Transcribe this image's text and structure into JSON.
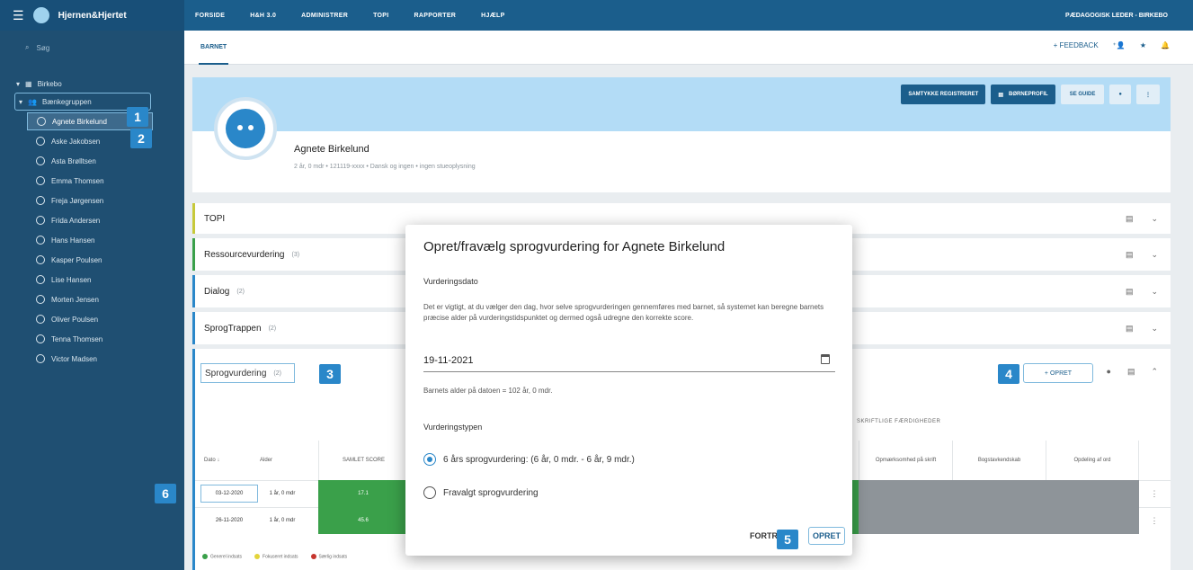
{
  "topbar": {
    "brand": "Hjernen&Hjertet",
    "nav": [
      "FORSIDE",
      "H&H 3.0",
      "ADMINISTRER",
      "TOPI",
      "RAPPORTER",
      "HJÆLP"
    ],
    "user": "PÆDAGOGISK LEDER - BIRKEBO"
  },
  "sidebar": {
    "search_placeholder": "Søg",
    "root": "Birkebo",
    "group": "Bænkegruppen",
    "children": [
      "Agnete Birkelund",
      "Aske Jakobsen",
      "Asta Brølltsen",
      "Emma Thomsen",
      "Freja Jørgensen",
      "Frida Andersen",
      "Hans Hansen",
      "Kasper Poulsen",
      "Lise Hansen",
      "Morten Jensen",
      "Oliver Poulsen",
      "Tenna Thomsen",
      "Victor Madsen"
    ]
  },
  "subheader": {
    "tab": "BARNET",
    "feedback": "+ FEEDBACK"
  },
  "profile": {
    "name": "Agnete Birkelund",
    "meta": "2 år, 0 mdr • 121119-xxxx • Dansk og ingen • ingen stueoplysning",
    "btn_samtykke": "SAMTYKKE REGISTRERET",
    "btn_born": "BØRNEPROFIL",
    "btn_guide": "SE GUIDE"
  },
  "sections": {
    "topi": "TOPI",
    "ressource": "Ressourcevurdering",
    "ressource_count": "(3)",
    "dialog": "Dialog",
    "dialog_count": "(2)",
    "sprogtrappen": "SprogTrappen",
    "sprogtrappen_count": "(2)",
    "sprog": "Sprogvurdering",
    "sprog_count": "(2)",
    "opret": "+ OPRET"
  },
  "table": {
    "skrift_header": "SKRIFTLIGE FÆRDIGHEDER",
    "col_dato": "Dato ↓",
    "col_alder": "Alder",
    "col_samlet": "SAMLET SCORE",
    "col_opm": "Opmærksomhed på skrift",
    "col_bogstav": "Bogstavkendskab",
    "col_opdeling": "Opdeling af ord",
    "rows": [
      {
        "dato": "03-12-2020",
        "alder": "1 år, 0 mdr",
        "score": "17.1"
      },
      {
        "dato": "26-11-2020",
        "alder": "1 år, 0 mdr",
        "score": "45.6"
      }
    ],
    "legend": [
      "Generel indsats",
      "Fokuseret indsats",
      "Særlig indsats"
    ]
  },
  "modal": {
    "title": "Opret/fravælg sprogvurdering for Agnete Birkelund",
    "date_label": "Vurderingsdato",
    "description": "Det er vigtigt, at du vælger den dag, hvor selve sprogvurderingen gennemføres med barnet, så systemet kan beregne barnets præcise alder på vurderingstidspunktet og dermed også udregne den korrekte score.",
    "date_value": "19-11-2021",
    "age_text": "Barnets alder på datoen = 102 år, 0 mdr.",
    "type_label": "Vurderingstypen",
    "option1": "6 års sprogvurdering: (6 år, 0 mdr. - 6 år, 9 mdr.)",
    "option2": "Fravalgt sprogvurdering",
    "btn_fortryd": "FORTR",
    "btn_opret": "OPRET"
  },
  "badges": [
    "1",
    "2",
    "3",
    "4",
    "5",
    "6"
  ],
  "colors": {
    "primary": "#1b5e8c",
    "sidebar": "#1f4f72",
    "accent": "#2a87c9",
    "green": "#3aa04a",
    "grey_cell": "#8e9499"
  }
}
